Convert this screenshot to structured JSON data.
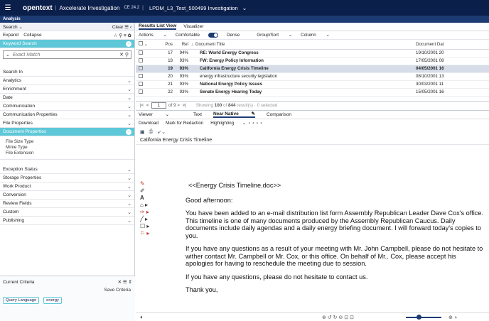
{
  "topbar": {
    "brand": "opentext",
    "product": "Axcelerate Investigation",
    "version": "CE 24.2",
    "breadcrumb": "LPDM_L3_Test_500499 Investigation"
  },
  "subbar": {
    "label": "Analysis"
  },
  "left": {
    "search_label": "Search",
    "clear": "Clear",
    "expand": "Expand",
    "collapse": "Collapse",
    "keyword_search": "Keyword Search",
    "match_placeholder": "Exact Match",
    "search_in": "Search In",
    "facets_top": [
      "Analytics",
      "Enrichment",
      "Date",
      "Communication",
      "Communication Properties",
      "File Properties"
    ],
    "document_properties": "Document Properties",
    "doc_prop_items": [
      "File Size Type",
      "Mime Type",
      "File Extension"
    ],
    "facets_bottom": [
      "Exception Status",
      "Storage Properties",
      "Work Product",
      "Conversion",
      "Review Fields",
      "Custom",
      "Publishing"
    ],
    "current_criteria": "Current Criteria",
    "save_criteria": "Save Criteria",
    "chips": [
      "Query Language",
      "energy"
    ]
  },
  "results": {
    "tabs": [
      "Results List View",
      "Visualizer"
    ],
    "toolbar": [
      "Actions",
      "Comfortable",
      "Dense",
      "Group/Sort",
      "Column"
    ],
    "columns": [
      "Pos",
      "Rel",
      "Document Title",
      "Document Dat"
    ],
    "rows": [
      {
        "pos": "17",
        "rel": "94%",
        "title": "RE: World Energy Congress",
        "date": "19/10/2001 20"
      },
      {
        "pos": "18",
        "rel": "93%",
        "title": "FW: Energy Policy Information",
        "date": "17/05/2001 08"
      },
      {
        "pos": "19",
        "rel": "93%",
        "title": "California Energy Crisis Timeline",
        "date": "04/05/2001 16"
      },
      {
        "pos": "20",
        "rel": "93%",
        "title": "energy infrastructure security legislation",
        "date": "08/10/2001 13"
      },
      {
        "pos": "21",
        "rel": "93%",
        "title": "National Energy Policy Issues",
        "date": "30/03/2001 11"
      },
      {
        "pos": "22",
        "rel": "93%",
        "title": "Senate Energy Hearing Today",
        "date": "15/05/2001 16"
      }
    ],
    "pager": {
      "page": "1",
      "of": "of 9",
      "showing_prefix": "Showing",
      "showing_count": "100",
      "showing_mid": "of",
      "showing_total": "844",
      "showing_suffix": "result(s) · 0 selected"
    }
  },
  "viewer": {
    "tabs": [
      "Viewer",
      "Text",
      "Near Native",
      "Comparison"
    ],
    "tools": [
      "Download",
      "Mark for Redaction",
      "Highlighting"
    ],
    "doc_title": "California Energy Crisis Timeline",
    "heading": "<<Energy Crisis Timeline.doc>>",
    "greeting": "Good afternoon:",
    "para1": "You have been added to an e-mail distribution list form Assembly Republican Leader Dave Cox's office.  This timeline is one of many documents produced by the Assembly Republican Caucus.  Daily documents include daily agendas and a daily energy briefing document.  I will forward today's copies to you.",
    "para2": "If you have any questions as a result of your meeting with Mr. John Campbell, please do not hesitate to wither contact Mr. Campbell or Mr. Cox, or this office.  On behalf of Mr.. Cox, please accept his apologies for having to reschedule the meeting due to session.",
    "para3": "If you have any questions, please do not hesitate to contact us.",
    "closing": "Thank you,"
  }
}
